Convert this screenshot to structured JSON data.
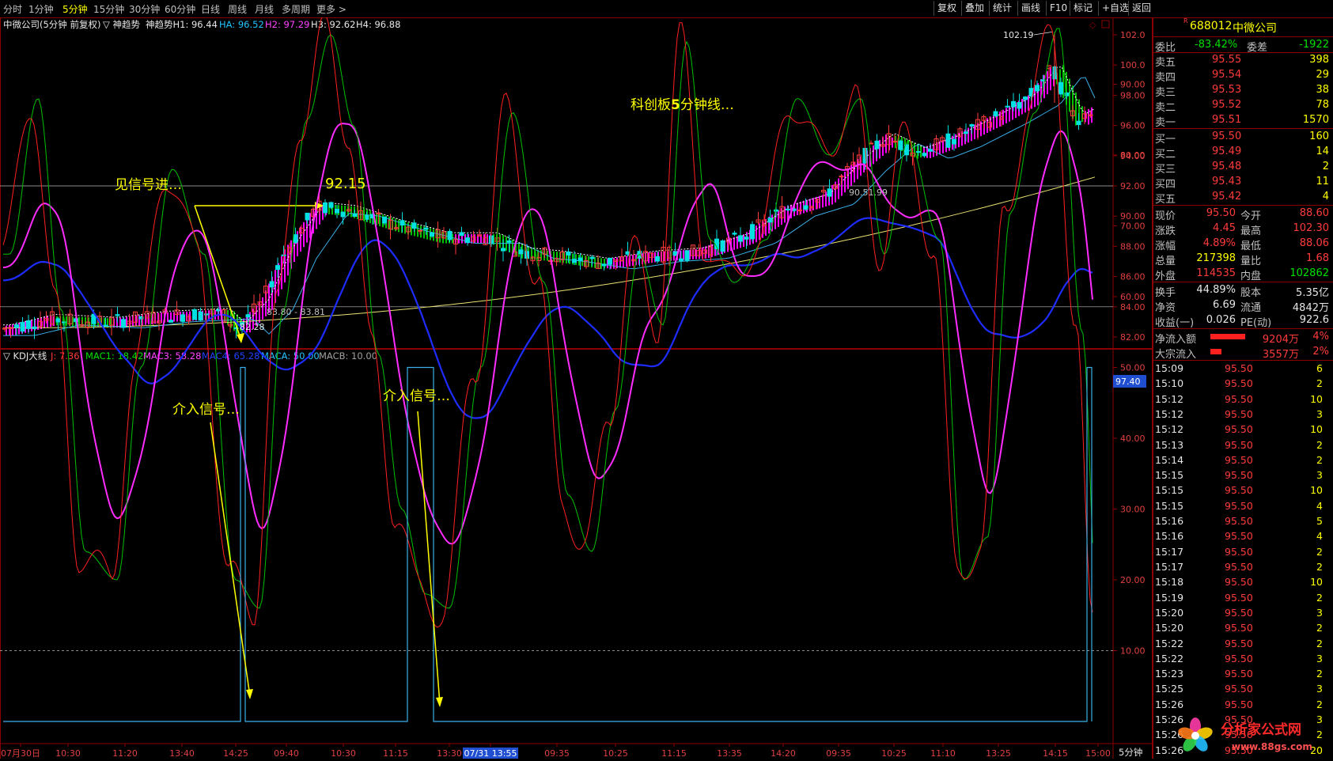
{
  "topbar": {
    "timeframes": [
      "分时",
      "1分钟",
      "5分钟",
      "15分钟",
      "30分钟",
      "60分钟",
      "日线",
      "周线",
      "月线",
      "多周期",
      "更多 >"
    ],
    "active_timeframe": "5分钟",
    "right_buttons": [
      "复权",
      "叠加",
      "统计",
      "画线",
      "F10",
      "标记",
      "+自选",
      "返回"
    ]
  },
  "main_chart": {
    "header": {
      "title": "中微公司(5分钟 前复权)",
      "indicator": "▽ 神趋势",
      "h1": "神趋势H1: 96.44",
      "ha": "HA: 96.52",
      "h2": "H2: 97.29",
      "h3": "H3: 92.62",
      "h4": "H4: 96.88"
    },
    "y_ticks": [
      "102.0",
      "100.0",
      "98.00",
      "96.00",
      "94.00",
      "92.00",
      "90.00",
      "88.00",
      "86.00",
      "84.00",
      "82.00"
    ],
    "annotations": {
      "see_signal": "见信号进…",
      "price_label": "92.15",
      "kechuang": "科创板",
      "kechuang_num": "5",
      "kechuang_tail": "分钟线…",
      "high_label": "102.19",
      "low_label": "82.28",
      "range_label": "83.80 - 83.81",
      "mid_label": "90.51.99"
    }
  },
  "kdj_panel": {
    "header": {
      "name": "▽ KDJ大线",
      "j": "J: 7.36",
      "mac1": "MAC1: 18.42",
      "mac3": "MAC3: 58.28",
      "mac4": "MAC4: 65.28",
      "maca": "MACA: 50.00",
      "macb": "MACB: 10.00"
    },
    "y_ticks": [
      "90.00",
      "80.00",
      "70.00",
      "60.00",
      "50.00",
      "40.00",
      "30.00",
      "20.00",
      "10.00"
    ],
    "value_badge": "97.40",
    "annotation_1": "介入信号…",
    "annotation_2": "介入信号…"
  },
  "x_axis": {
    "labels": [
      "07月30日",
      "10:30",
      "11:20",
      "13:40",
      "14:25",
      "09:40",
      "10:30",
      "11:15",
      "13:30",
      "07/31 13:55",
      "09:35",
      "10:25",
      "11:15",
      "13:35",
      "14:20",
      "09:35",
      "10:25",
      "11:10",
      "13:25",
      "14:15",
      "15:00"
    ],
    "period": "5分钟"
  },
  "stock": {
    "code": "688012",
    "name": "中微公司",
    "wei_bi_label": "委比",
    "wei_bi": "-83.42%",
    "wei_cha_label": "委差",
    "wei_cha": "-1922",
    "asks": [
      {
        "label": "卖五",
        "price": "95.55",
        "vol": "398"
      },
      {
        "label": "卖四",
        "price": "95.54",
        "vol": "29"
      },
      {
        "label": "卖三",
        "price": "95.53",
        "vol": "38"
      },
      {
        "label": "卖二",
        "price": "95.52",
        "vol": "78"
      },
      {
        "label": "卖一",
        "price": "95.51",
        "vol": "1570"
      }
    ],
    "bids": [
      {
        "label": "买一",
        "price": "95.50",
        "vol": "160"
      },
      {
        "label": "买二",
        "price": "95.49",
        "vol": "14"
      },
      {
        "label": "买三",
        "price": "95.48",
        "vol": "2"
      },
      {
        "label": "买四",
        "price": "95.43",
        "vol": "11"
      },
      {
        "label": "买五",
        "price": "95.42",
        "vol": "4"
      }
    ],
    "quote": [
      {
        "l1": "现价",
        "v1": "95.50",
        "c1": "red",
        "l2": "今开",
        "v2": "88.60",
        "c2": "red"
      },
      {
        "l1": "涨跌",
        "v1": "4.45",
        "c1": "red",
        "l2": "最高",
        "v2": "102.30",
        "c2": "red"
      },
      {
        "l1": "涨幅",
        "v1": "4.89%",
        "c1": "red",
        "l2": "最低",
        "v2": "88.06",
        "c2": "red"
      },
      {
        "l1": "总量",
        "v1": "217398",
        "c1": "yel",
        "l2": "量比",
        "v2": "1.68",
        "c2": "red"
      },
      {
        "l1": "外盘",
        "v1": "114535",
        "c1": "red",
        "l2": "内盘",
        "v2": "102862",
        "c2": "grn"
      }
    ],
    "finance": [
      {
        "l1": "换手",
        "v1": "44.89%",
        "l2": "股本",
        "v2": "5.35亿"
      },
      {
        "l1": "净资",
        "v1": "6.69",
        "l2": "流通",
        "v2": "4842万"
      },
      {
        "l1": "收益(一)",
        "v1": "0.026",
        "l2": "PE(动)",
        "v2": "922.6"
      }
    ],
    "flows": [
      {
        "label": "净流入额",
        "value": "9204万",
        "pct": "4%",
        "bar": 0.55
      },
      {
        "label": "大宗流入",
        "value": "3557万",
        "pct": "2%",
        "bar": 0.18
      }
    ],
    "ticks": [
      {
        "t": "15:09",
        "p": "95.50",
        "v": "6"
      },
      {
        "t": "15:10",
        "p": "95.50",
        "v": "2"
      },
      {
        "t": "15:12",
        "p": "95.50",
        "v": "10"
      },
      {
        "t": "15:12",
        "p": "95.50",
        "v": "3"
      },
      {
        "t": "15:12",
        "p": "95.50",
        "v": "10"
      },
      {
        "t": "15:13",
        "p": "95.50",
        "v": "2"
      },
      {
        "t": "15:14",
        "p": "95.50",
        "v": "2"
      },
      {
        "t": "15:15",
        "p": "95.50",
        "v": "3"
      },
      {
        "t": "15:15",
        "p": "95.50",
        "v": "10"
      },
      {
        "t": "15:15",
        "p": "95.50",
        "v": "4"
      },
      {
        "t": "15:16",
        "p": "95.50",
        "v": "5"
      },
      {
        "t": "15:16",
        "p": "95.50",
        "v": "4"
      },
      {
        "t": "15:17",
        "p": "95.50",
        "v": "2"
      },
      {
        "t": "15:17",
        "p": "95.50",
        "v": "2"
      },
      {
        "t": "15:18",
        "p": "95.50",
        "v": "10"
      },
      {
        "t": "15:19",
        "p": "95.50",
        "v": "2"
      },
      {
        "t": "15:20",
        "p": "95.50",
        "v": "3"
      },
      {
        "t": "15:20",
        "p": "95.50",
        "v": "2"
      },
      {
        "t": "15:22",
        "p": "95.50",
        "v": "2"
      },
      {
        "t": "15:22",
        "p": "95.50",
        "v": "3"
      },
      {
        "t": "15:23",
        "p": "95.50",
        "v": "2"
      },
      {
        "t": "15:25",
        "p": "95.50",
        "v": "3"
      },
      {
        "t": "15:26",
        "p": "95.50",
        "v": "2"
      },
      {
        "t": "15:26",
        "p": "95.50",
        "v": "3"
      },
      {
        "t": "15:26",
        "p": "95.50",
        "v": "2"
      },
      {
        "t": "15:26",
        "p": "95.50",
        "v": "20"
      }
    ]
  },
  "watermark": {
    "brand": "分析家公式网",
    "url": "www.88gs.com"
  },
  "colors": {
    "up": "#ff3b3b",
    "down": "#00e0e0",
    "pink": "#ff00ff",
    "green": "#00e000",
    "yellow": "#ffff00",
    "frame": "#8b0000"
  }
}
